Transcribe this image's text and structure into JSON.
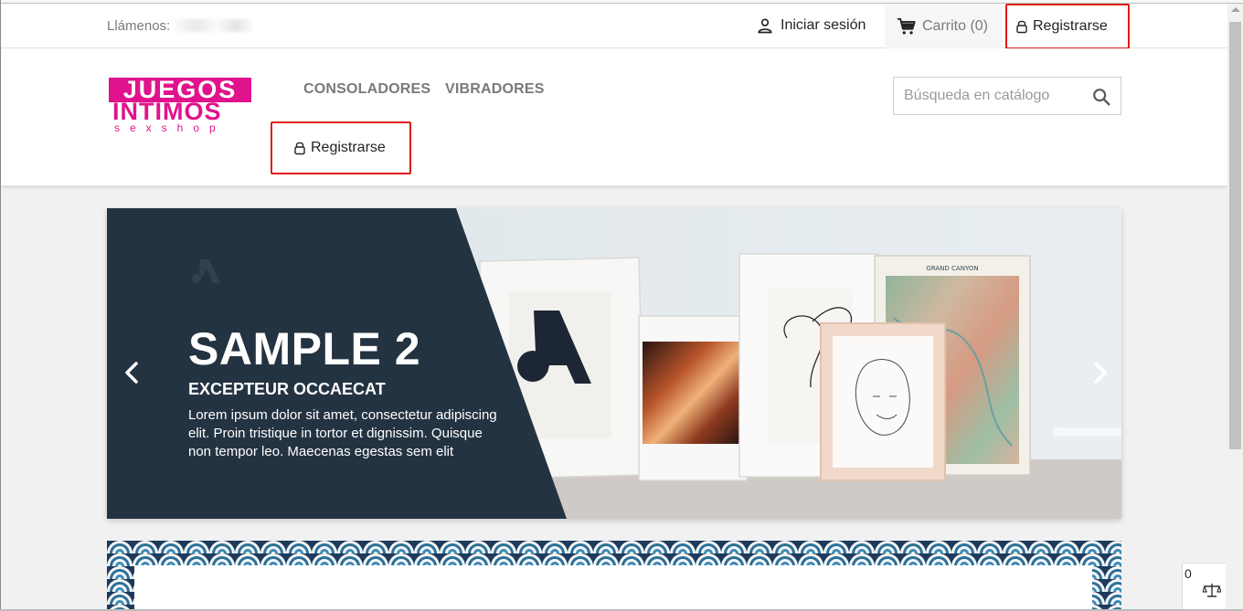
{
  "topbar": {
    "contact_label": "Llámenos:",
    "contact_phone_visible": "( ... ...",
    "signin_label": "Iniciar sesión",
    "cart_label": "Carrito (0)",
    "register_label": "Registrarse"
  },
  "header": {
    "logo": {
      "line1": "JUEGOS",
      "line2": "INTIMOS",
      "line3": "sexshop",
      "color": "#e0138c"
    },
    "menu": [
      {
        "label": "CONSOLADORES"
      },
      {
        "label": "VIBRADORES"
      }
    ],
    "register_label": "Registrarse",
    "search": {
      "placeholder": "Búsqueda en catálogo",
      "value": ""
    }
  },
  "slider": {
    "title": "SAMPLE 2",
    "subtitle": "EXCEPTEUR OCCAECAT",
    "text": "Lorem ipsum dolor sit amet, consectetur adipiscing elit. Proin tristique in tortor et dignissim. Quisque non tempor leo. Maecenas egestas sem elit",
    "panel_color": "#243342",
    "poster_map_title": "GRAND CANYON"
  },
  "compare": {
    "count": "0"
  },
  "colors": {
    "accent_red": "#e01b1b",
    "text_dark": "#232323",
    "text_muted": "#7a7a7a"
  }
}
